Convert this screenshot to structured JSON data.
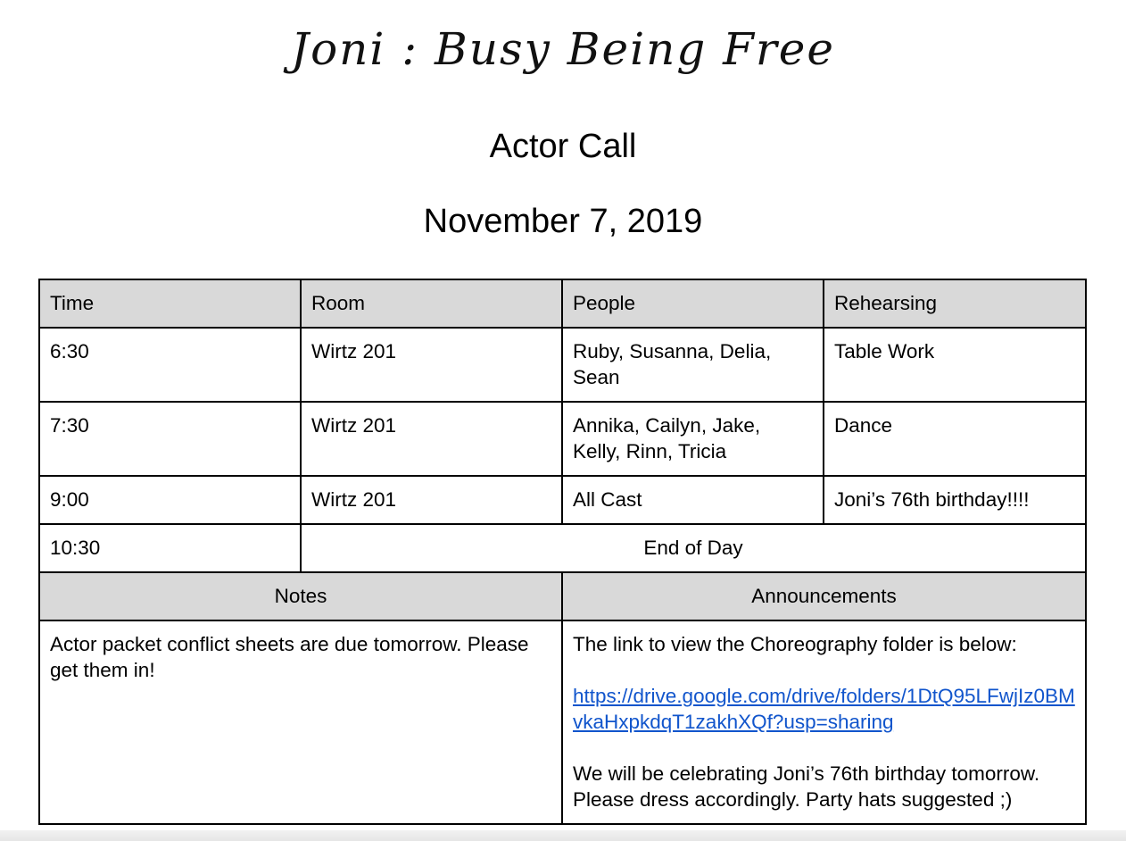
{
  "header": {
    "logo_text": "Joni : Busy Being Free",
    "title": "Actor Call",
    "date": "November 7, 2019"
  },
  "schedule": {
    "columns": [
      "Time",
      "Room",
      "People",
      "Rehearsing"
    ],
    "rows": [
      {
        "time": "6:30",
        "room": "Wirtz 201",
        "people": "Ruby, Susanna, Delia, Sean",
        "rehearsing": "Table Work"
      },
      {
        "time": "7:30",
        "room": "Wirtz 201",
        "people": "Annika, Cailyn, Jake, Kelly, Rinn, Tricia",
        "rehearsing": "Dance"
      },
      {
        "time": "9:00",
        "room": "Wirtz 201",
        "people": "All Cast",
        "rehearsing": "Joni’s 76th birthday!!!!"
      }
    ],
    "end_row": {
      "time": "10:30",
      "label": "End of Day"
    }
  },
  "notes": {
    "heading": "Notes",
    "text": "Actor packet conflict sheets are due tomorrow. Please get them in!"
  },
  "announcements": {
    "heading": "Announcements",
    "intro": "The link to view the Choreography folder is below:",
    "link": "https://drive.google.com/drive/folders/1DtQ95LFwjIz0BMvkaHxpkdqT1zakhXQf?usp=sharing",
    "message": "We will be celebrating Joni’s 76th birthday tomorrow. Please dress accordingly. Party hats suggested ;)"
  }
}
